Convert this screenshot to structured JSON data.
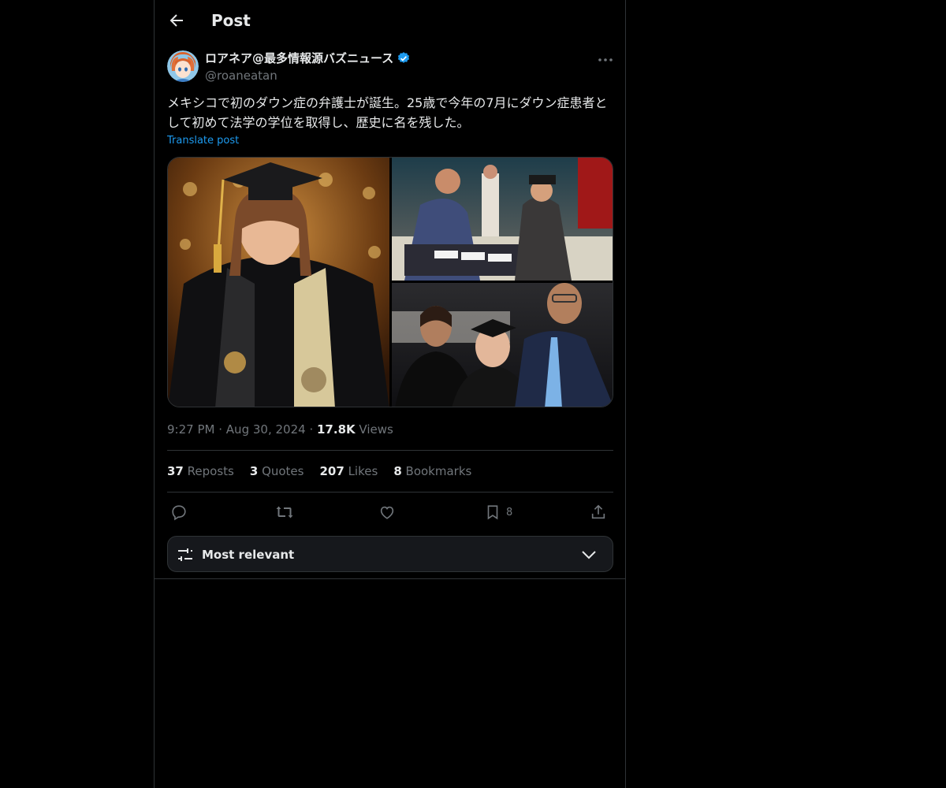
{
  "header": {
    "title": "Post"
  },
  "author": {
    "name": "ロアネア@最多情報源バズニュース",
    "handle": "@roaneatan",
    "verified": true
  },
  "post": {
    "text": "メキシコで初のダウン症の弁護士が誕生。25歳で今年の7月にダウン症患者として初めて法学の学位を取得し、歴史に名を残した。",
    "translate_label": "Translate post",
    "time": "9:27 PM",
    "date": "Aug 30, 2024",
    "views_count": "17.8K",
    "views_label": "Views",
    "separator": "·"
  },
  "stats": {
    "reposts_count": "37",
    "reposts_label": "Reposts",
    "quotes_count": "3",
    "quotes_label": "Quotes",
    "likes_count": "207",
    "likes_label": "Likes",
    "bookmarks_count": "8",
    "bookmarks_label": "Bookmarks"
  },
  "actions": {
    "bookmark_count": "8"
  },
  "sort": {
    "label": "Most relevant"
  },
  "icons": {
    "back": "arrow-left-icon",
    "verified": "verified-badge-icon",
    "more": "more-horizontal-icon",
    "reply": "reply-icon",
    "repost": "repost-icon",
    "like": "heart-icon",
    "bookmark": "bookmark-icon",
    "share": "share-icon",
    "sort": "sliders-icon",
    "chevron": "chevron-down-icon"
  },
  "colors": {
    "background": "#000000",
    "accent": "#1d9bf0",
    "muted": "#71767b",
    "text": "#e7e9ea",
    "border": "#2f3336"
  }
}
